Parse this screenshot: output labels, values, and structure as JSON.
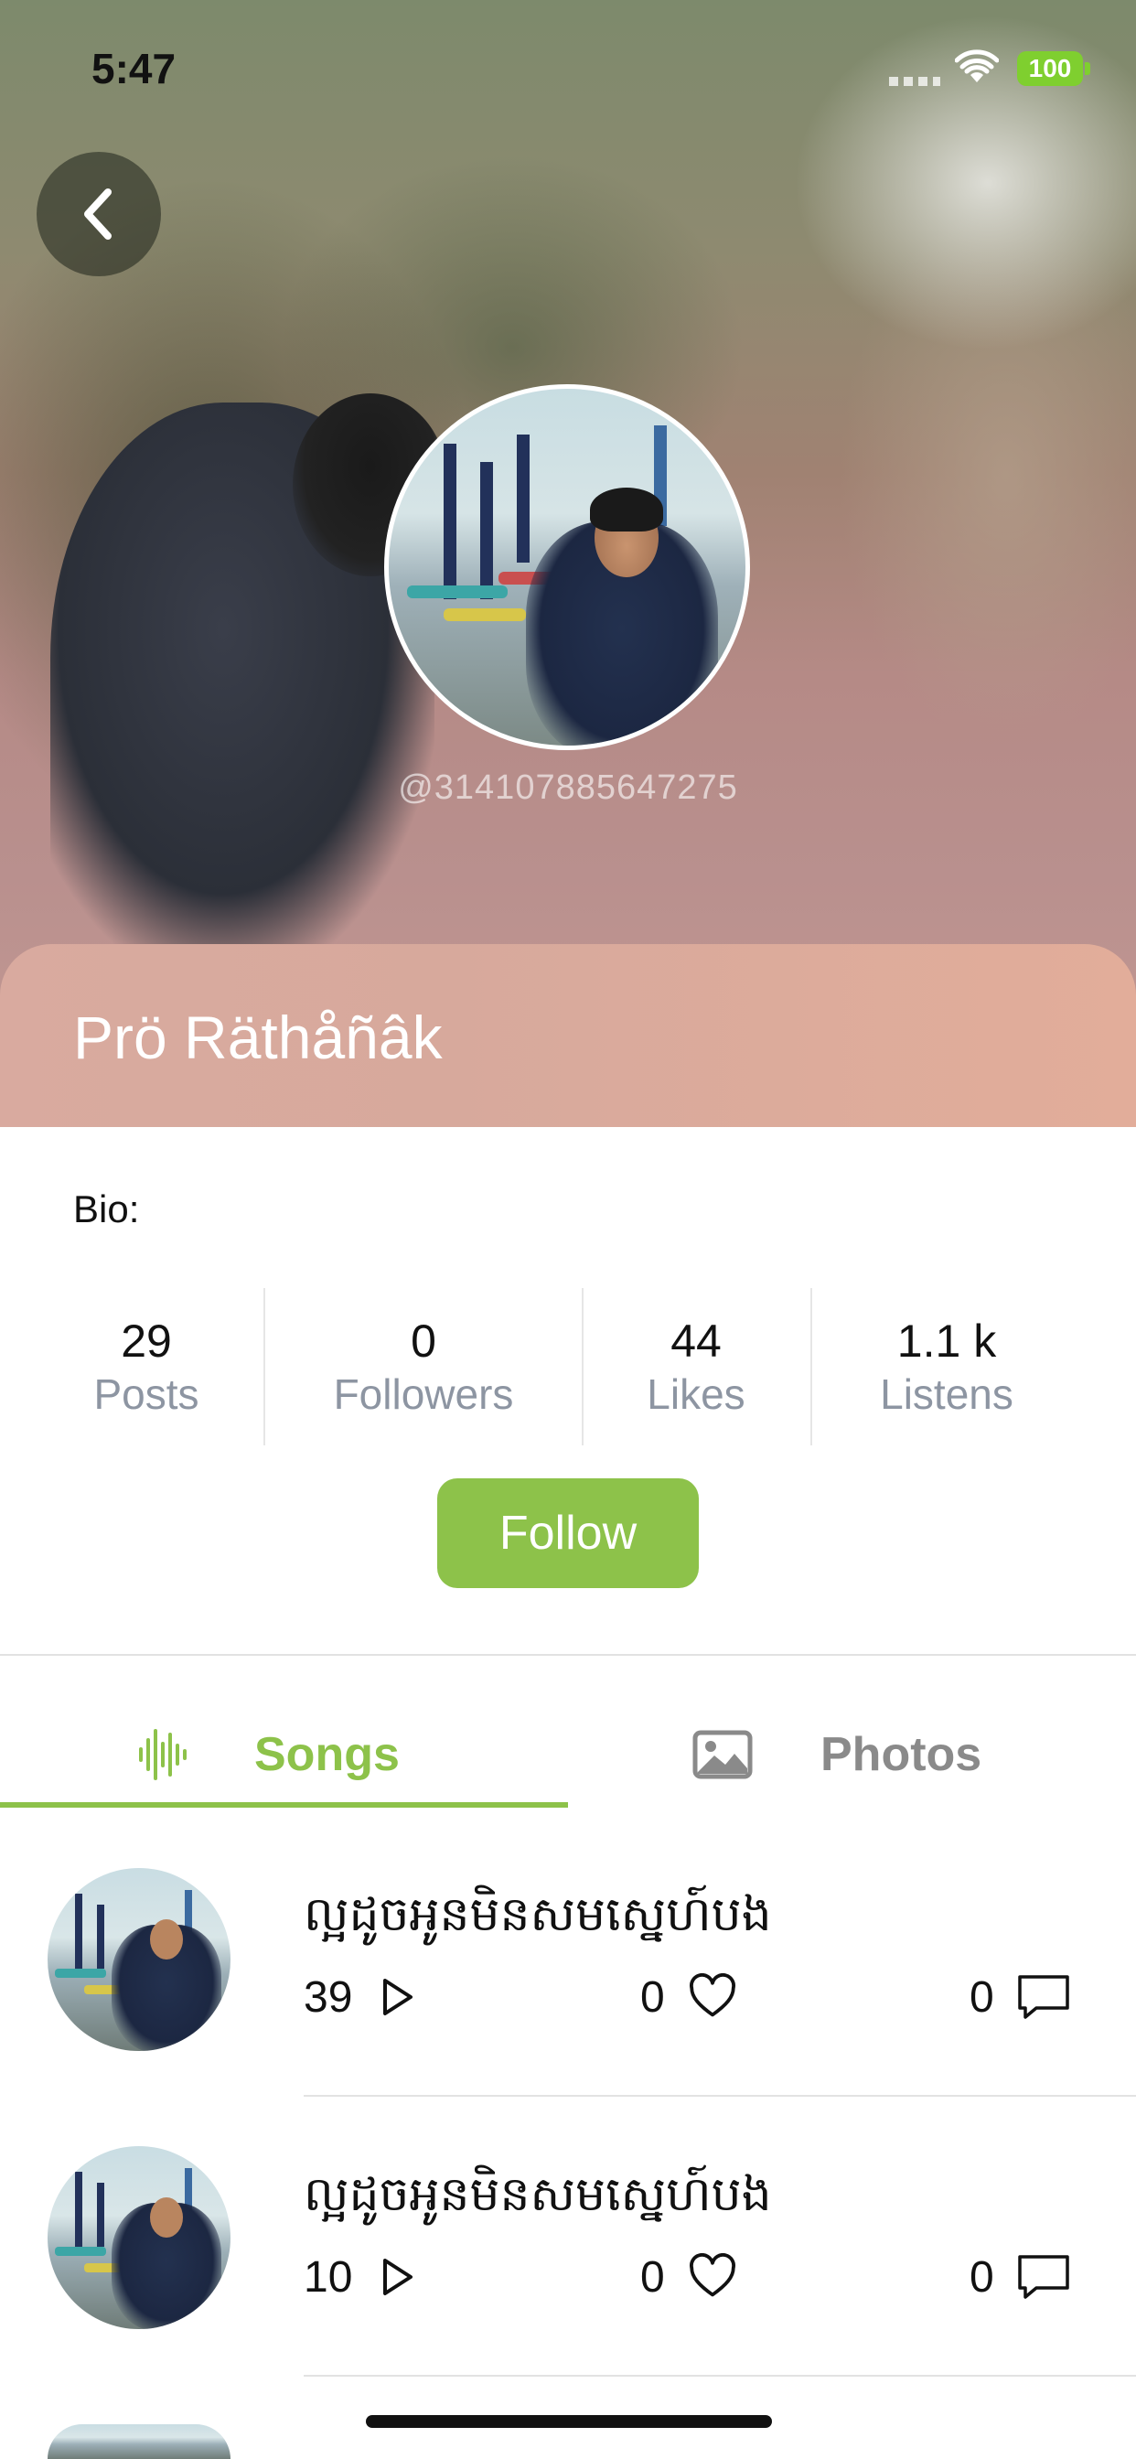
{
  "status_bar": {
    "time": "5:47",
    "battery": "100"
  },
  "profile": {
    "handle": "@314107885647275",
    "name": "Prö Räthåñâk",
    "bio_label": "Bio:",
    "follow_label": "Follow"
  },
  "stats": [
    {
      "value": "29",
      "label": "Posts"
    },
    {
      "value": "0",
      "label": "Followers"
    },
    {
      "value": "44",
      "label": "Likes"
    },
    {
      "value": "1.1 k",
      "label": "Listens"
    }
  ],
  "tabs": [
    {
      "label": "Songs",
      "icon": "audio-wave-icon",
      "selected": true
    },
    {
      "label": "Photos",
      "icon": "image-icon",
      "selected": false
    }
  ],
  "songs": [
    {
      "title": "ល្អដូចអូនមិនសមស្នេហ៍បង",
      "plays": "39",
      "likes": "0",
      "comments": "0"
    },
    {
      "title": "ល្អដូចអូនមិនសមស្នេហ៍បង",
      "plays": "10",
      "likes": "0",
      "comments": "0"
    }
  ],
  "colors": {
    "accent": "#8dc24a",
    "name_card": "#d9aa9f",
    "muted_text": "#8d95a2"
  }
}
